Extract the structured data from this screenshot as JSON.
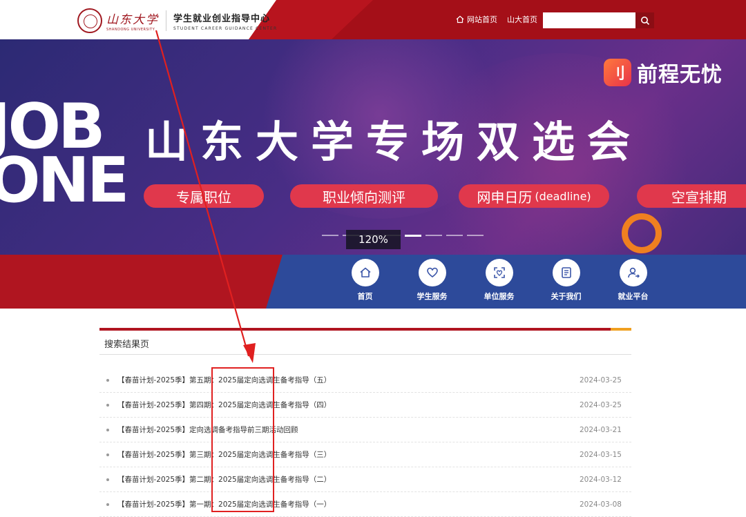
{
  "header": {
    "university_cn": "山东大学",
    "university_en": "SHANDONG UNIVERSITY",
    "center_cn": "学生就业创业指导中心",
    "center_en": "STUDENT CAREER GUIDANCE CENTER",
    "nav": [
      {
        "label": "网站首页"
      },
      {
        "label": "山大首页"
      }
    ],
    "search": {
      "value": "",
      "placeholder": ""
    }
  },
  "banner": {
    "big_letters": [
      "JOB",
      "ONE"
    ],
    "brand": "前程无忧",
    "brand_icon": "刂",
    "headline": "山东大学专场双选会",
    "pills": [
      {
        "label": "专属职位"
      },
      {
        "label": "职业倾向测评"
      },
      {
        "label": "网申日历",
        "suffix": "(deadline)"
      },
      {
        "label": "空宣排期"
      }
    ],
    "zoom": "120%",
    "active_slide": 4,
    "slide_count": 8
  },
  "menu": [
    {
      "label": "首页",
      "icon": "home-icon"
    },
    {
      "label": "学生服务",
      "icon": "heart-icon"
    },
    {
      "label": "单位服务",
      "icon": "scan-heart-icon"
    },
    {
      "label": "关于我们",
      "icon": "document-icon"
    },
    {
      "label": "就业平台",
      "icon": "user-add-icon"
    }
  ],
  "results": {
    "title": "搜索结果页",
    "items": [
      {
        "title": "【春苗计划-2025季】第五期：2025届定向选调生备考指导（五）",
        "date": "2024-03-25"
      },
      {
        "title": "【春苗计划-2025季】第四期：2025届定向选调生备考指导（四）",
        "date": "2024-03-25"
      },
      {
        "title": "【春苗计划-2025季】定向选调备考指导前三期活动回顾",
        "date": "2024-03-21"
      },
      {
        "title": "【春苗计划-2025季】第三期：2025届定向选调生备考指导（三）",
        "date": "2024-03-15"
      },
      {
        "title": "【春苗计划-2025季】第二期：2025届定向选调生备考指导（二）",
        "date": "2024-03-12"
      },
      {
        "title": "【春苗计划-2025季】第一期：2025届定向选调生备考指导（一）",
        "date": "2024-03-08"
      }
    ]
  },
  "colors": {
    "brand_red": "#b8141e",
    "banner_purple": "#3a2a7a",
    "pill_red": "#e0384c",
    "menu_blue": "#2d4a9a",
    "annotation_red": "#e02020"
  }
}
